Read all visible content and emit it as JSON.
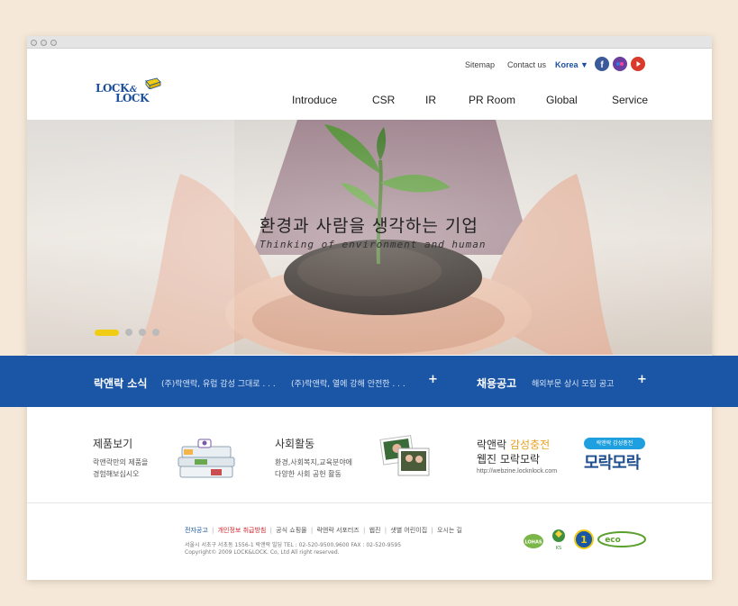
{
  "colors": {
    "brand_blue": "#1a56a5",
    "accent_yellow": "#f0cc12",
    "background": "#f5e8d8",
    "red_link": "#d2232a"
  },
  "header": {
    "logo_line1": "LOCK",
    "logo_amp": "&",
    "logo_line2": "LOCK",
    "util": {
      "sitemap": "Sitemap",
      "contact": "Contact us",
      "language": "Korea ▼"
    },
    "social": [
      "facebook-icon",
      "flickr-icon",
      "youtube-icon"
    ],
    "nav": [
      "Introduce",
      "CSR",
      "IR",
      "PR Room",
      "Global",
      "Service"
    ]
  },
  "hero": {
    "title": "환경과 사람을 생각하는 기업",
    "subtitle": "Thinking of environment and human",
    "slides_total": 4,
    "slide_active": 1
  },
  "news": {
    "title": "락앤락 소식",
    "items": [
      "(주)락앤락, 유럽 감성 그대로 . . .",
      "(주)락앤락, 열에 강해 안전한 . . ."
    ],
    "more": "+",
    "jobs_title": "채용공고",
    "jobs_item": "해외부문 상시 모집 공고",
    "jobs_more": "+"
  },
  "promos": {
    "products": {
      "title": "제품보기",
      "desc1": "락앤락만의 제품을",
      "desc2": "경험해보십시오"
    },
    "social": {
      "title": "사회활동",
      "desc1": "환경,사회복지,교육분야에",
      "desc2": "다양한 사회 공헌 활동"
    },
    "webzine": {
      "title_a": "락앤락",
      "title_b": "감성충전",
      "subtitle": "웹진 모락모락",
      "url": "http://webzine.locknlock.com",
      "badge": "락앤락 감성충전",
      "logo_text": "모락모락"
    }
  },
  "footer": {
    "links": [
      "전자공고",
      "개인정보 취급방침",
      "공식 쇼핑몰",
      "락앤락 서포터즈",
      "웹진",
      "샛별 어린이집",
      "오시는 길"
    ],
    "separator": "|",
    "address": "서울시 서초구 서초동 1556-1 락앤락 빌딩   TEL : 02-520-9500,9600  FAX : 02-520-9595",
    "copyright": "Copyright© 2009 LOCK&LOCK. Co, Ltd All right reserved.",
    "certs": [
      "LOHAS",
      "KS",
      "1",
      "eco"
    ]
  }
}
